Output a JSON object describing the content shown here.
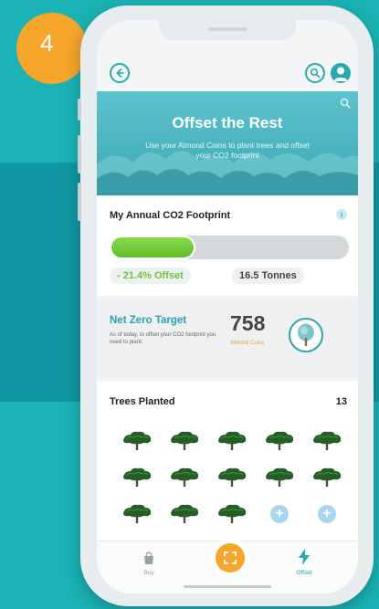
{
  "step": {
    "number": "4"
  },
  "colors": {
    "background": "#1bb3b5",
    "band": "#1097a3",
    "accent": "#27a9ad",
    "orange": "#f5a62b",
    "green": "#6cc63a"
  },
  "header": {
    "back_icon": "back-arrow-icon",
    "search_icon": "search-icon",
    "profile_icon": "user-icon"
  },
  "hero": {
    "title": "Offset the Rest",
    "subtitle": "Use your Almond Coins to plant trees and offset your CO2 footprint"
  },
  "footprint": {
    "title": "My Annual CO2 Footprint",
    "info": "i",
    "progress": 0.36,
    "offset_label": "- 21.4% Offset",
    "tonnes_label": "16.5 Tonnes"
  },
  "net_zero": {
    "title": "Net Zero Target",
    "text": "As of today, to offset your CO2 footprint you need to plant:",
    "value": "758",
    "unit": "Almond Coins"
  },
  "trees": {
    "title": "Trees Planted",
    "count": "13",
    "planted": 13,
    "add_slots": 2
  },
  "nav": {
    "buy_label": "Buy",
    "offset_label": "Offset"
  }
}
